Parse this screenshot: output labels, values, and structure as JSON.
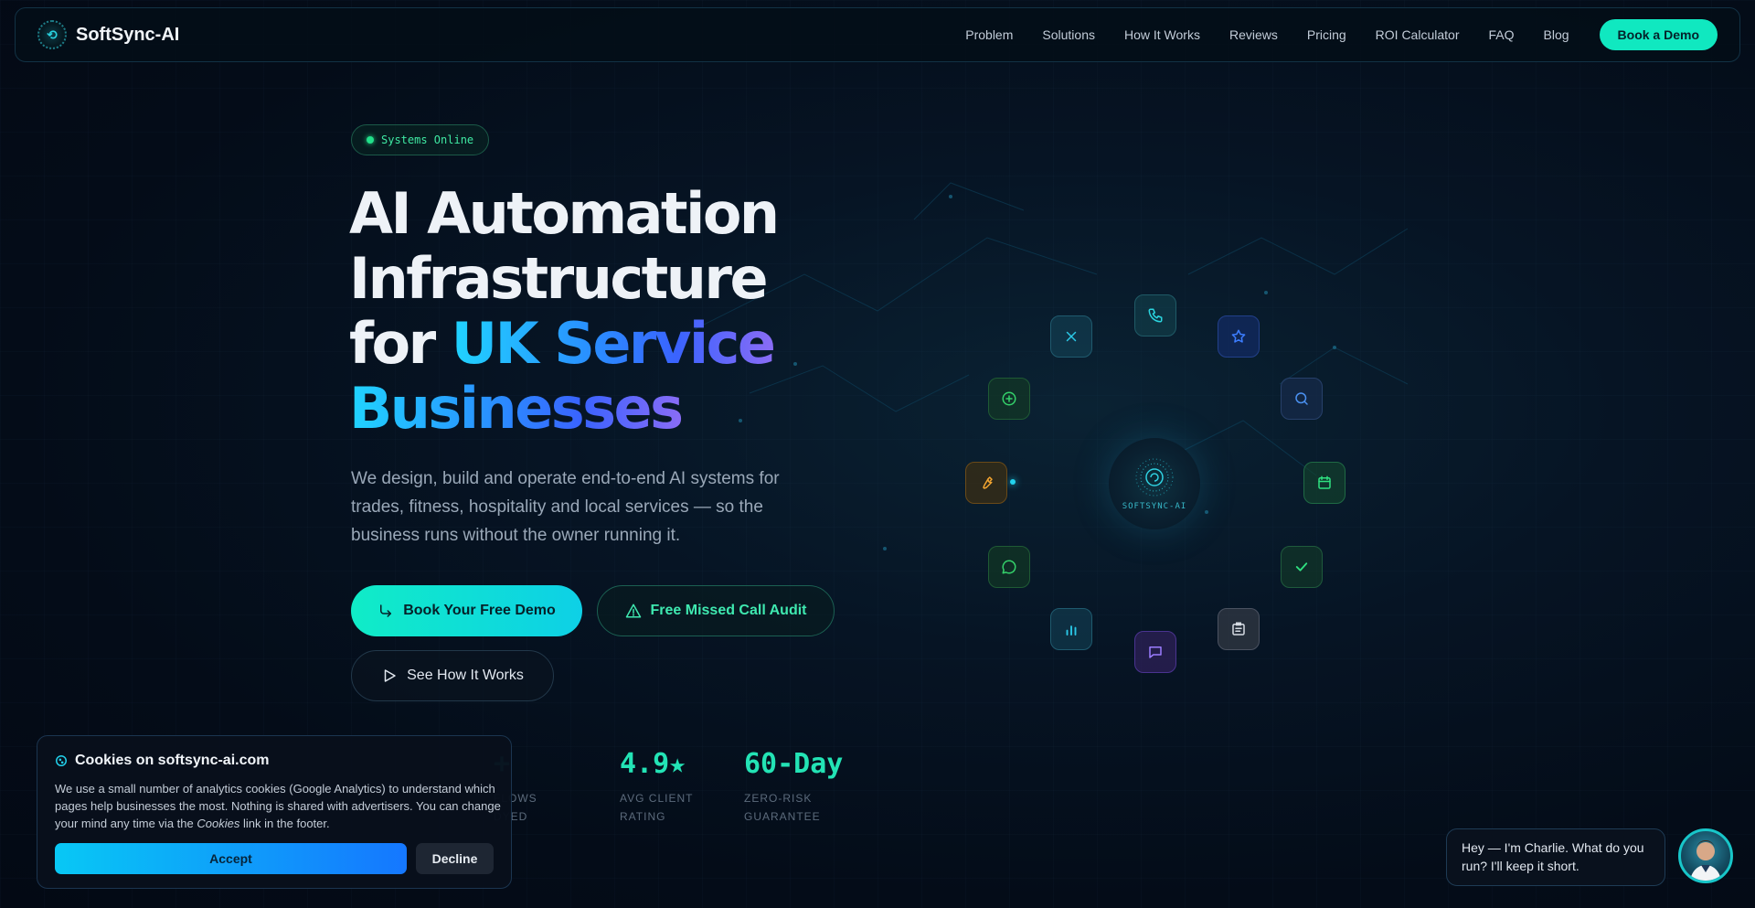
{
  "nav": {
    "brand": "SoftSync-AI",
    "links": [
      "Problem",
      "Solutions",
      "How It Works",
      "Reviews",
      "Pricing",
      "ROI Calculator",
      "FAQ",
      "Blog"
    ],
    "cta": "Book a Demo"
  },
  "hero": {
    "badge": "Systems Online",
    "headline_line1": "AI Automation",
    "headline_line2": "Infrastructure",
    "headline_for": "for",
    "headline_accent1": "UK Service",
    "headline_accent2": "Businesses",
    "subtitle": "We design, build and operate end-to-end AI systems for trades, fitness, hospitality and local services — so the business runs without the owner running it.",
    "primary_button": "Book Your Free Demo",
    "outline_button": "Free Missed Call Audit",
    "ghost_button": "See How It Works"
  },
  "stats": [
    {
      "value": "+",
      "label1": "FLOWS",
      "label2": "DYED"
    },
    {
      "value": "4.9★",
      "label1": "AVG CLIENT",
      "label2": "RATING"
    },
    {
      "value": "60-Day",
      "label1": "ZERO-RISK",
      "label2": "GUARANTEE"
    }
  ],
  "orbit": {
    "core_label": "SOFTSYNC-AI",
    "icons": [
      "x-icon",
      "phone-icon",
      "star-icon",
      "plus-circle-icon",
      "search-icon",
      "wrench-icon",
      "calendar-icon",
      "message-icon",
      "check-icon",
      "chart-icon",
      "chat-icon",
      "clipboard-icon"
    ]
  },
  "cookie": {
    "title": "Cookies on softsync-ai.com",
    "text_before": "We use a small number of analytics cookies (Google Analytics) to understand which pages help businesses the most. Nothing is shared with advertisers. You can change your mind any time via the",
    "text_link": "Cookies",
    "text_after": "link in the footer.",
    "accept": "Accept",
    "decline": "Decline"
  },
  "chat": {
    "message": "Hey — I'm Charlie. What do you run? I'll keep it short."
  },
  "colors": {
    "accent": "#10e8c0",
    "accent_blue": "#2a8cff",
    "background": "#040c18"
  }
}
